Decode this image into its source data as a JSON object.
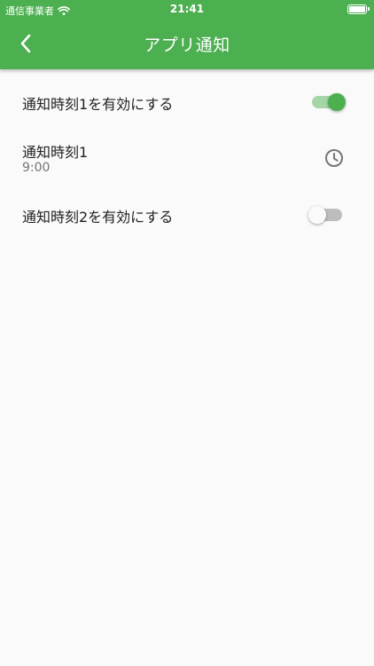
{
  "status_bar": {
    "carrier": "通信事業者",
    "time": "21:41",
    "wifi_icon": "wifi-icon",
    "battery_icon": "battery-icon"
  },
  "app_bar": {
    "title": "アプリ通知",
    "back_icon": "chevron-left-icon",
    "background_color": "#4caf50"
  },
  "settings": {
    "items": [
      {
        "label": "通知時刻1を有効にする",
        "type": "switch",
        "enabled": true
      },
      {
        "label": "通知時刻1",
        "value": "9:00",
        "type": "time-picker",
        "icon": "clock-icon"
      },
      {
        "label": "通知時刻2を有効にする",
        "type": "switch",
        "enabled": false
      }
    ]
  },
  "colors": {
    "accent": "#4caf50",
    "accent_light": "#a5d6a7",
    "switch_off_track": "#bdbdbd",
    "background": "#fafafa"
  }
}
